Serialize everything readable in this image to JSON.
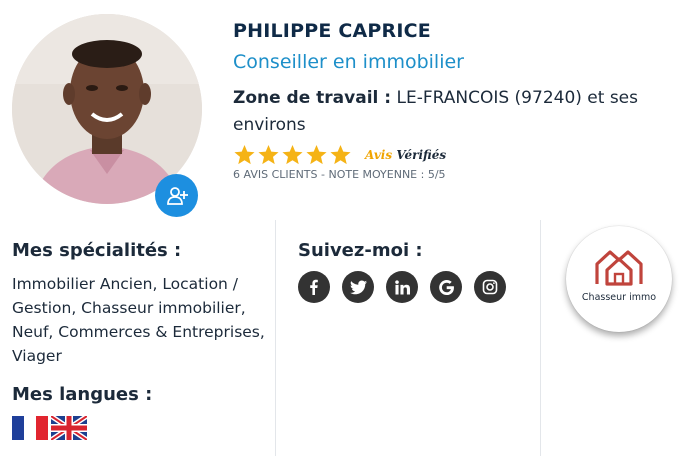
{
  "profile": {
    "name": "PHILIPPE CAPRICE",
    "role": "Conseiller en immobilier",
    "zone_label": "Zone de travail :",
    "zone_value": "LE-FRANCOIS (97240) et ses environs"
  },
  "reviews": {
    "stars": 5,
    "max_stars": 5,
    "brand_part1": "Avis",
    "brand_part2": "Vérifiés",
    "summary": "6 AVIS CLIENTS - NOTE MOYENNE : 5/5",
    "star_color": "#f5b316"
  },
  "specialties": {
    "title": "Mes spécialités :",
    "text": "Immobilier Ancien, Location / Gestion, Chasseur immobilier, Neuf, Commerces & Entreprises, Viager"
  },
  "languages": {
    "title": "Mes langues :",
    "flags": [
      "french-flag",
      "british-flag"
    ]
  },
  "social": {
    "title": "Suivez-moi :",
    "networks": [
      "facebook",
      "twitter",
      "linkedin",
      "google",
      "instagram"
    ],
    "icon_bg": "#333333"
  },
  "badge": {
    "label": "Chasseur immo",
    "icon_color": "#c0443c"
  },
  "colors": {
    "name": "#0f2a47",
    "role": "#1d8fc9",
    "add_button": "#1d8fe0"
  }
}
